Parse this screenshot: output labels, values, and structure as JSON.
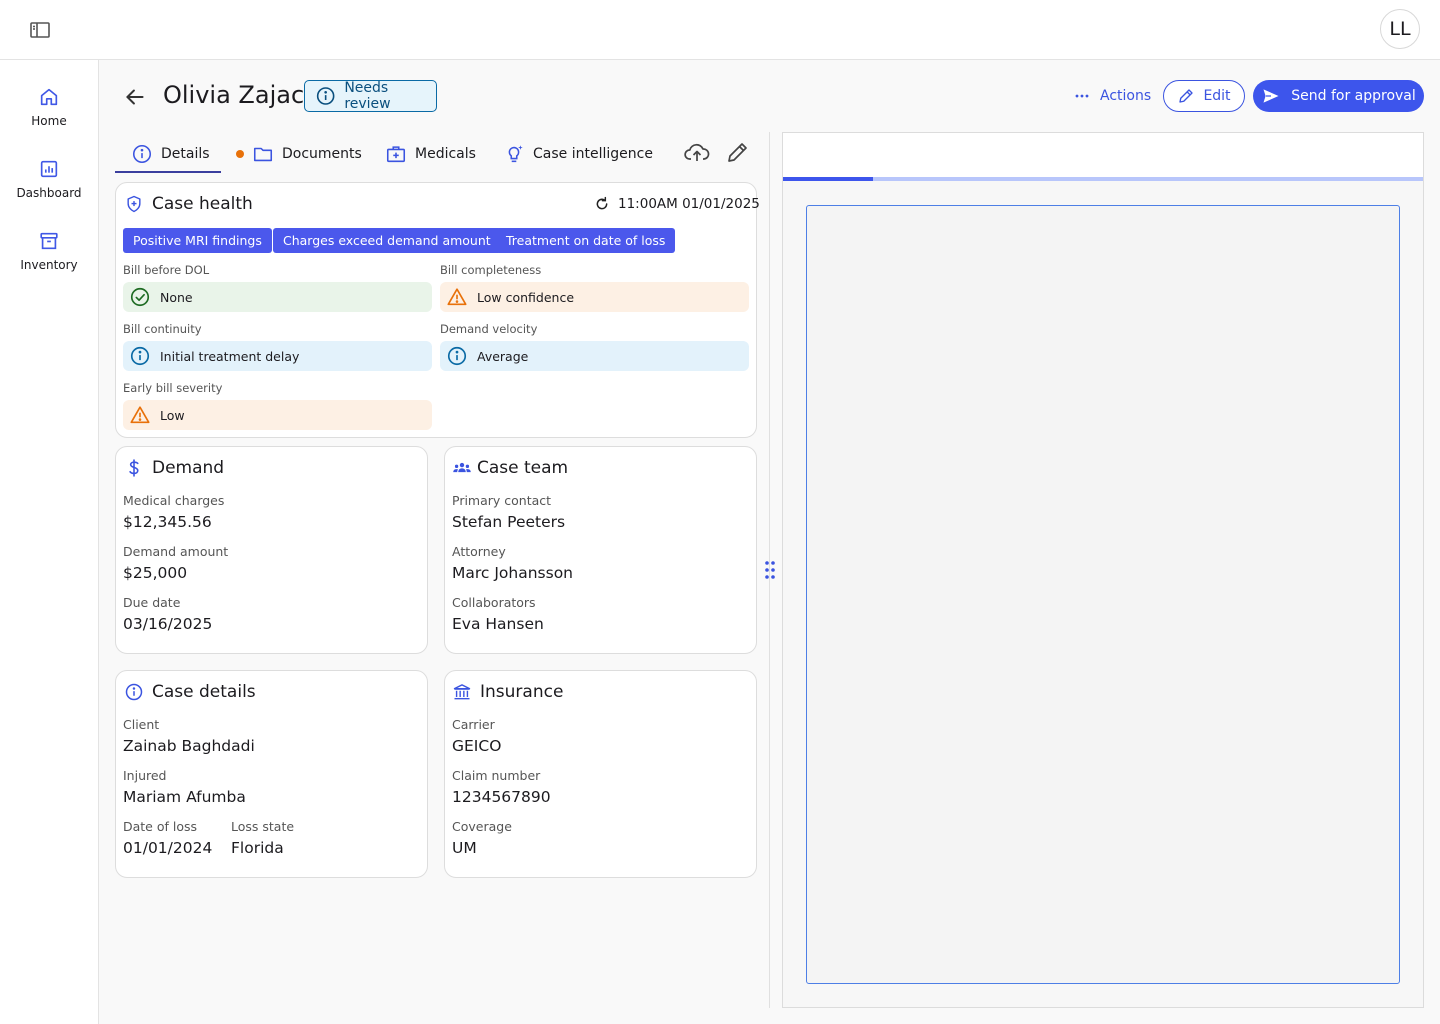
{
  "topbar": {
    "avatar_initials": "LL"
  },
  "sidenav": {
    "items": [
      {
        "label": "Home",
        "icon": "home-icon"
      },
      {
        "label": "Dashboard",
        "icon": "dashboard-icon"
      },
      {
        "label": "Inventory",
        "icon": "inventory-icon"
      }
    ]
  },
  "header": {
    "name": "Olivia Zajac",
    "status_badge": "Needs review",
    "actions_label": "Actions",
    "edit_label": "Edit",
    "send_label": "Send for approval"
  },
  "tabs": [
    {
      "label": "Details",
      "active": true
    },
    {
      "label": "Documents",
      "has_dot": true
    },
    {
      "label": "Medicals"
    },
    {
      "label": "Case intelligence"
    }
  ],
  "case_health": {
    "title": "Case health",
    "timestamp": "11:00AM 01/01/2025",
    "chips": [
      "Positive MRI findings",
      "Charges exceed demand amount",
      "Treatment on date of loss"
    ],
    "metrics": [
      {
        "label": "Bill before DOL",
        "value": "None",
        "status": "green"
      },
      {
        "label": "Bill completeness",
        "value": "Low confidence",
        "status": "orange"
      },
      {
        "label": "Bill continuity",
        "value": "Initial treatment delay",
        "status": "blue"
      },
      {
        "label": "Demand velocity",
        "value": "Average",
        "status": "blue"
      },
      {
        "label": "Early bill severity",
        "value": "Low",
        "status": "orange"
      }
    ]
  },
  "demand": {
    "title": "Demand",
    "fields": [
      {
        "label": "Medical charges",
        "value": "$12,345.56"
      },
      {
        "label": "Demand amount",
        "value": "$25,000"
      },
      {
        "label": "Due date",
        "value": "03/16/2025"
      }
    ]
  },
  "case_team": {
    "title": "Case team",
    "fields": [
      {
        "label": "Primary contact",
        "value": "Stefan Peeters"
      },
      {
        "label": "Attorney",
        "value": "Marc Johansson"
      },
      {
        "label": "Collaborators",
        "value": "Eva Hansen"
      }
    ]
  },
  "case_details": {
    "title": "Case details",
    "fields": [
      {
        "label": "Client",
        "value": "Zainab Baghdadi"
      },
      {
        "label": "Injured",
        "value": "Mariam Afumba"
      },
      {
        "label": "Date of loss",
        "value": "01/01/2024"
      },
      {
        "label": "Loss state",
        "value": "Florida"
      }
    ]
  },
  "insurance": {
    "title": "Insurance",
    "fields": [
      {
        "label": "Carrier",
        "value": "GEICO"
      },
      {
        "label": "Claim number",
        "value": "1234567890"
      },
      {
        "label": "Coverage",
        "value": "UM"
      }
    ]
  },
  "preview": {
    "progress": 0.14
  },
  "colors": {
    "accent": "#3d55ec",
    "chip": "#4b58ec",
    "success": "#2e7d32",
    "warning": "#e8710a",
    "info": "#0a6aa5"
  }
}
